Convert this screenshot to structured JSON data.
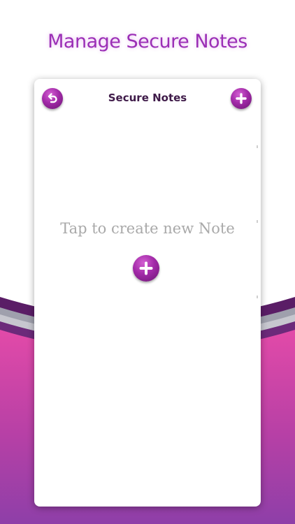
{
  "promo": {
    "headline": "Manage Secure Notes"
  },
  "app": {
    "title": "Secure Notes",
    "back_icon": "back-arrow-icon",
    "add_icon": "plus-icon"
  },
  "empty_state": {
    "message": "Tap to create new Note",
    "add_icon": "plus-icon"
  },
  "colors": {
    "accent": "#a22aa8",
    "accent_dark": "#6b1573",
    "title_text": "#3f1b49",
    "placeholder_text": "#a9a9a9",
    "headline_text": "#9b2fb6",
    "wave_pink": "#e24aa8",
    "wave_purple": "#8e3fa8"
  }
}
